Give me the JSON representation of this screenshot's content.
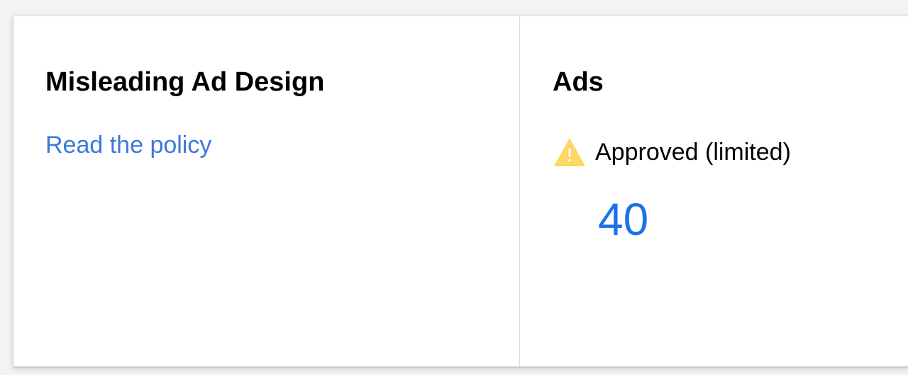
{
  "policy": {
    "title": "Misleading Ad Design",
    "link_label": "Read the policy"
  },
  "ads": {
    "title": "Ads",
    "status_icon": "warning-icon",
    "status_label": "Approved (limited)",
    "count": "40"
  },
  "colors": {
    "link": "#3c78d8",
    "count": "#1a73e8",
    "warning": "#fbc02d"
  }
}
